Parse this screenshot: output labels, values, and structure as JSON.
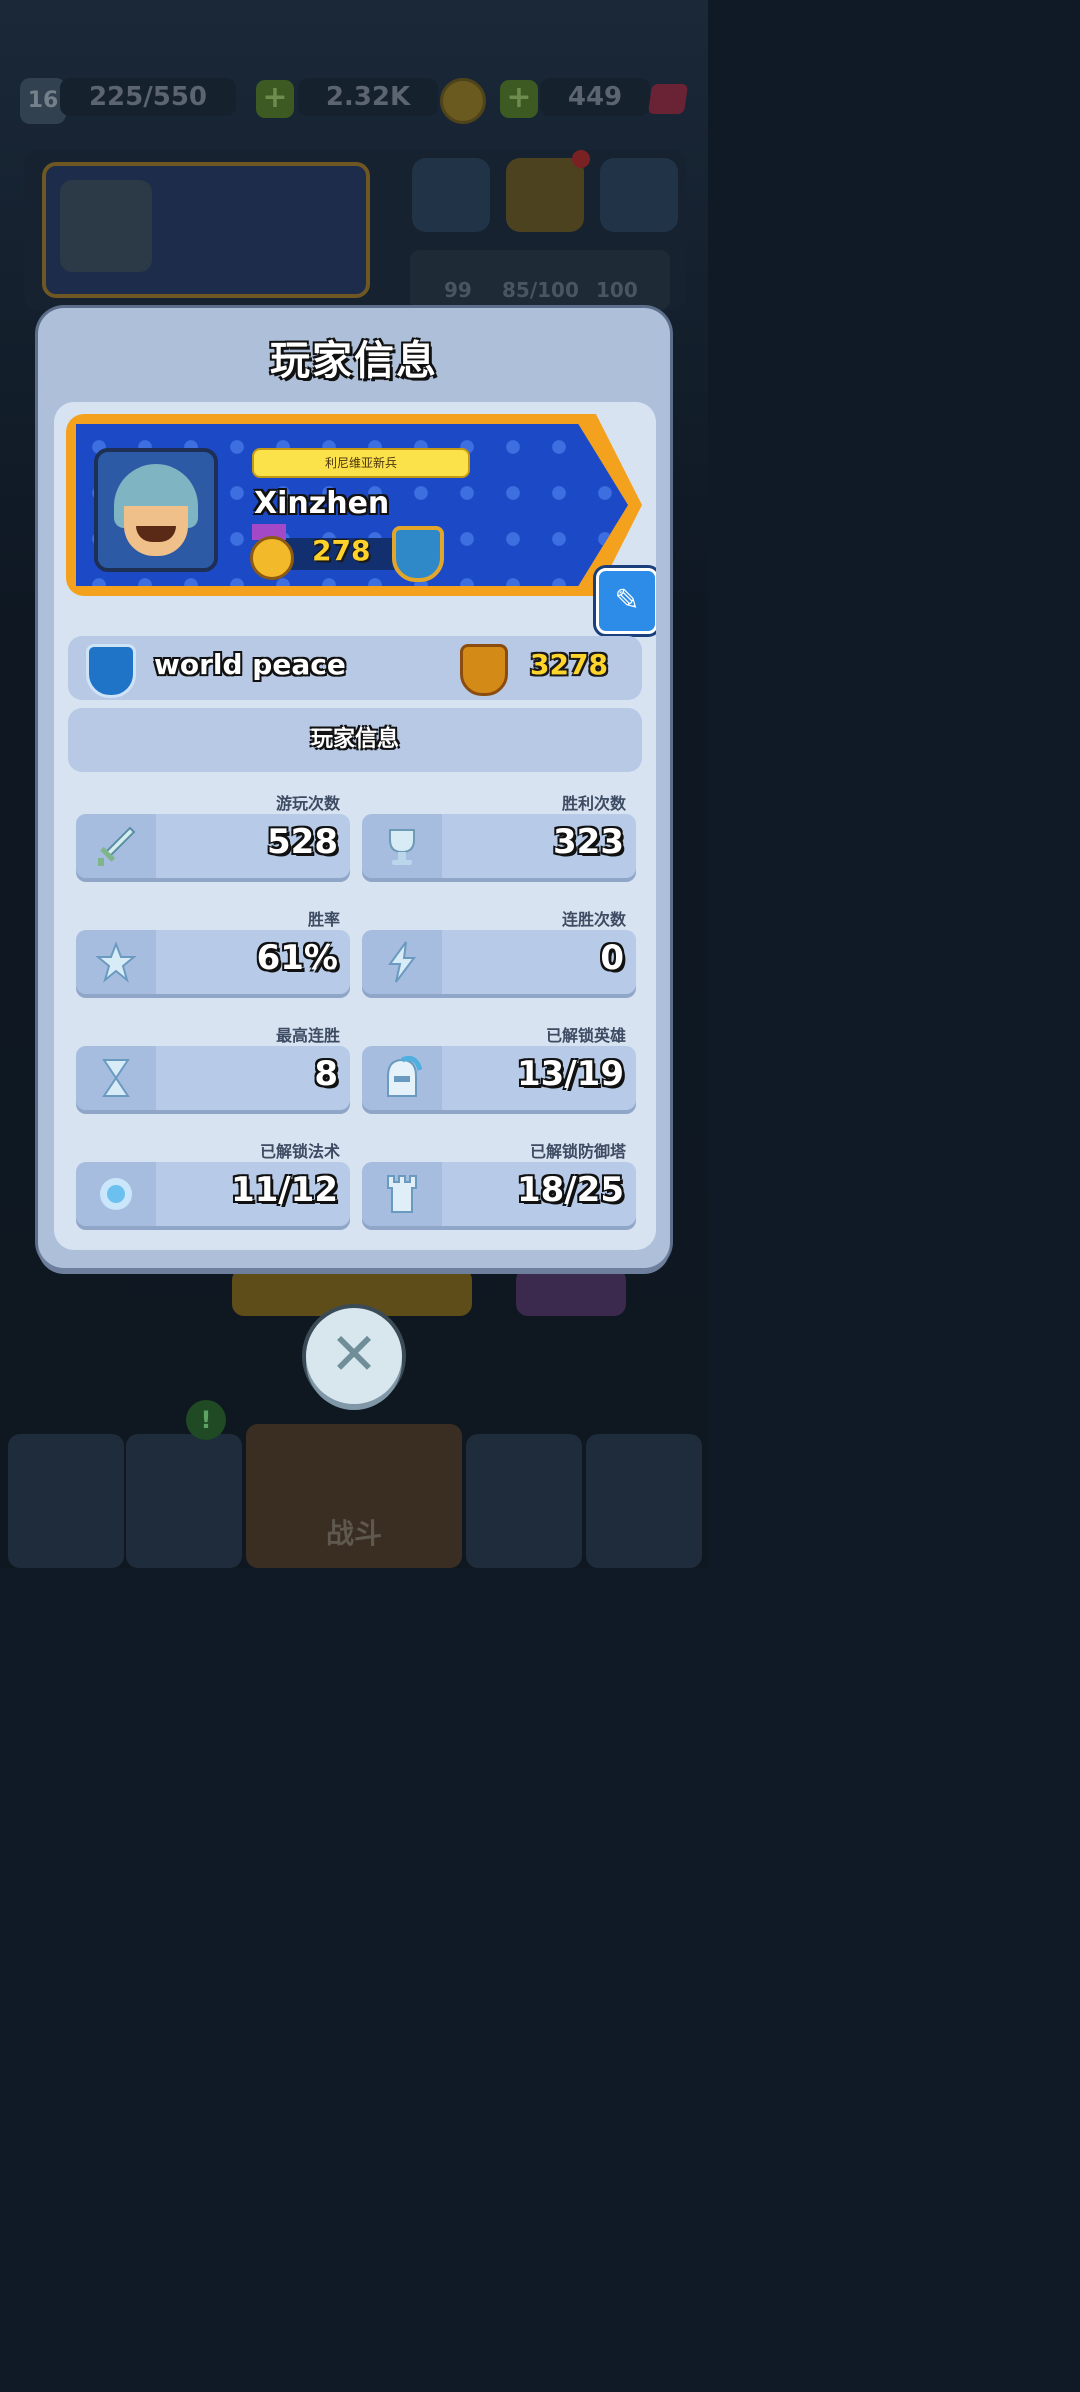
{
  "topbar": {
    "level": "16",
    "xp": "225/550",
    "coins": "2.32K",
    "gems": "449"
  },
  "bg": {
    "stat_left": "99",
    "progress": "85/100",
    "stat_right": "100",
    "nav_fight": "战斗"
  },
  "modal": {
    "title": "玩家信息",
    "profile": {
      "title_plate": "利尼维亚新兵",
      "name": "Xinzhen",
      "level": "278"
    },
    "guild": {
      "name": "world peace",
      "trophies": "3278"
    },
    "section_label": "玩家信息",
    "stats": [
      {
        "label": "游玩次数",
        "value": "528",
        "icon": "sword-icon"
      },
      {
        "label": "胜利次数",
        "value": "323",
        "icon": "trophy-icon"
      },
      {
        "label": "胜率",
        "value": "61%",
        "icon": "star-icon"
      },
      {
        "label": "连胜次数",
        "value": "0",
        "icon": "lightning-icon"
      },
      {
        "label": "最高连胜",
        "value": "8",
        "icon": "hourglass-icon"
      },
      {
        "label": "已解锁英雄",
        "value": "13/19",
        "icon": "helmet-icon"
      },
      {
        "label": "已解锁法术",
        "value": "11/12",
        "icon": "spell-orb-icon"
      },
      {
        "label": "已解锁防御塔",
        "value": "18/25",
        "icon": "tower-icon"
      }
    ]
  }
}
